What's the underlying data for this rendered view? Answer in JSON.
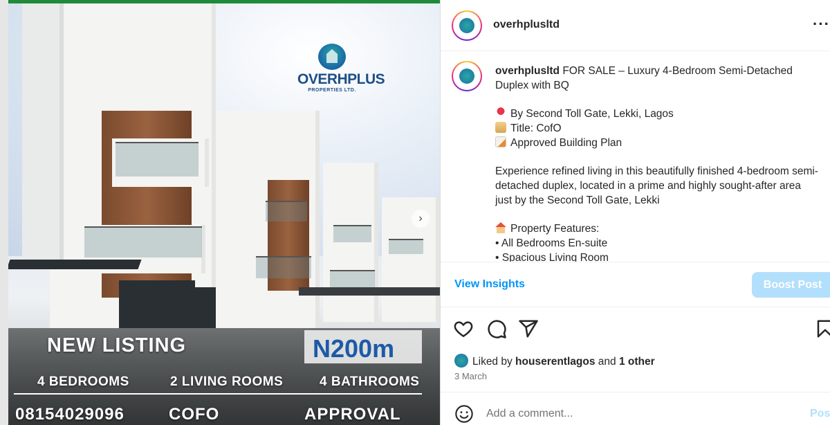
{
  "media": {
    "logo_word": "OVERHPLUS",
    "logo_sub": "PROPERTIES LTD.",
    "headline": "NEW LISTING",
    "price": "N200m",
    "features": [
      "4 BEDROOMS",
      "2 LIVING ROOMS",
      "4 BATHROOMS"
    ],
    "bottom": [
      "08154029096",
      "COFO",
      "APPROVAL"
    ],
    "next_icon": "chevron-right-icon"
  },
  "header": {
    "username": "overhplusltd",
    "more_icon": "more-horizontal-icon"
  },
  "caption": {
    "username": "overhplusltd",
    "title": "FOR SALE – Luxury 4-Bedroom Semi-Detached Duplex with BQ",
    "location": "By Second Toll Gate, Lekki, Lagos",
    "title_doc": "Title: CofO",
    "plan": "Approved Building Plan",
    "description": "Experience refined living in this beautifully finished 4-bedroom semi-detached duplex, located in a prime and highly sought-after area just by the Second Toll Gate, Lekki",
    "features_heading": "Property Features:",
    "features": [
      "• All Bedrooms En-suite",
      "• Spacious Living Room"
    ]
  },
  "actions": {
    "view_insights": "View Insights",
    "boost_post": "Boost Post",
    "icons": [
      "heart-icon",
      "comment-icon",
      "share-icon",
      "bookmark-icon"
    ]
  },
  "likes": {
    "prefix": "Liked by",
    "user": "houserentlagos",
    "and": "and",
    "others": "1 other"
  },
  "date": "3 March",
  "comment": {
    "placeholder": "Add a comment...",
    "post": "Post"
  },
  "colors": {
    "accent": "#0095f6",
    "boost_bg": "#b2dffc",
    "price_blue": "#1c5aa6",
    "logo_blue": "#1e4f87"
  }
}
